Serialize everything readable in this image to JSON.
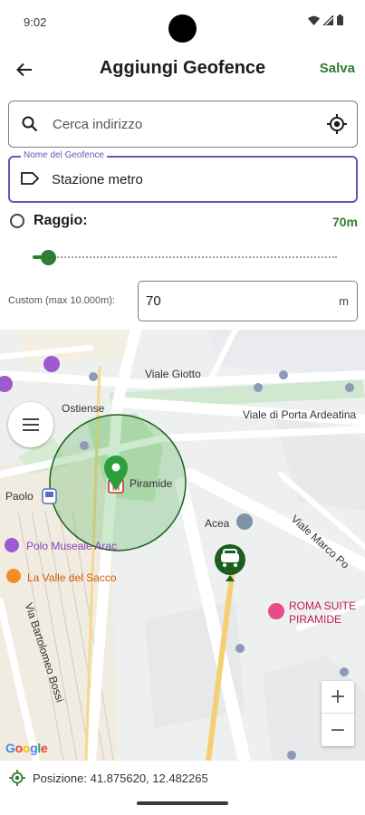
{
  "status_bar": {
    "time": "9:02"
  },
  "header": {
    "title": "Aggiungi Geofence",
    "save_label": "Salva",
    "back_icon": "arrow-back-icon"
  },
  "search": {
    "placeholder": "Cerca indirizzo",
    "value": ""
  },
  "name_field": {
    "label": "Nome del Geofence",
    "value": "Stazione metro"
  },
  "radius": {
    "label": "Raggio:",
    "value_text": "70m",
    "slider_fraction": 0.04
  },
  "custom": {
    "label": "Custom (max 10.000m):",
    "value": "70",
    "unit": "m"
  },
  "map": {
    "labels": {
      "viale_giotto": "Viale Giotto",
      "ostiense": "Ostiense",
      "porta_ardeatina": "Viale di Porta Ardeatina",
      "piramide": "Piramide",
      "paolo": "Paolo",
      "acea": "Acea",
      "marco_polo": "Viale Marco Po",
      "polo_museale": "Polo Museale Arac",
      "valle_sacco": "La Valle del Sacco",
      "bartolomeo": "Via Bartolomeo Bossi",
      "roma_suite": "ROMA SUITE",
      "roma_suite_2": "PIRAMIDE"
    },
    "zoom_in": "+",
    "zoom_out": "−",
    "google_logo": [
      "G",
      "o",
      "o",
      "g",
      "l",
      "e"
    ],
    "colors": {
      "circle_fill": "#4caf50",
      "circle_stroke": "#1b5e20",
      "marker": "#2e7d32",
      "car": "#1b5e20"
    }
  },
  "position": {
    "text": "Posizione: 41.875620, 12.482265"
  }
}
